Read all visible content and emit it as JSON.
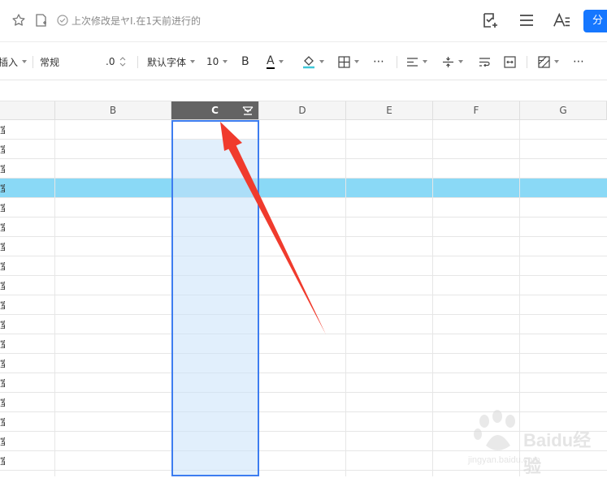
{
  "topbar": {
    "status": "上次修改是ヤI.在1天前进行的",
    "share_label": "分"
  },
  "toolbar": {
    "insert_label": "插入",
    "format_label": "常规",
    "decimal_label": ".0",
    "font_label": "默认字体",
    "font_size": "10",
    "bold_label": "B",
    "font_color_label": "A",
    "more_label": "⋯"
  },
  "grid": {
    "columns": [
      "B",
      "C",
      "D",
      "E",
      "F",
      "G"
    ],
    "selected_column": "C",
    "row_stub": "室",
    "highlighted_row": 4
  },
  "watermark": {
    "brand": "Baidu经验",
    "url": "jingyan.baidu.com"
  },
  "colors": {
    "accent": "#1677ff",
    "selection_border": "#3d7df0",
    "row_highlight": "#8ad9f6",
    "arrow": "#f03b2d"
  }
}
